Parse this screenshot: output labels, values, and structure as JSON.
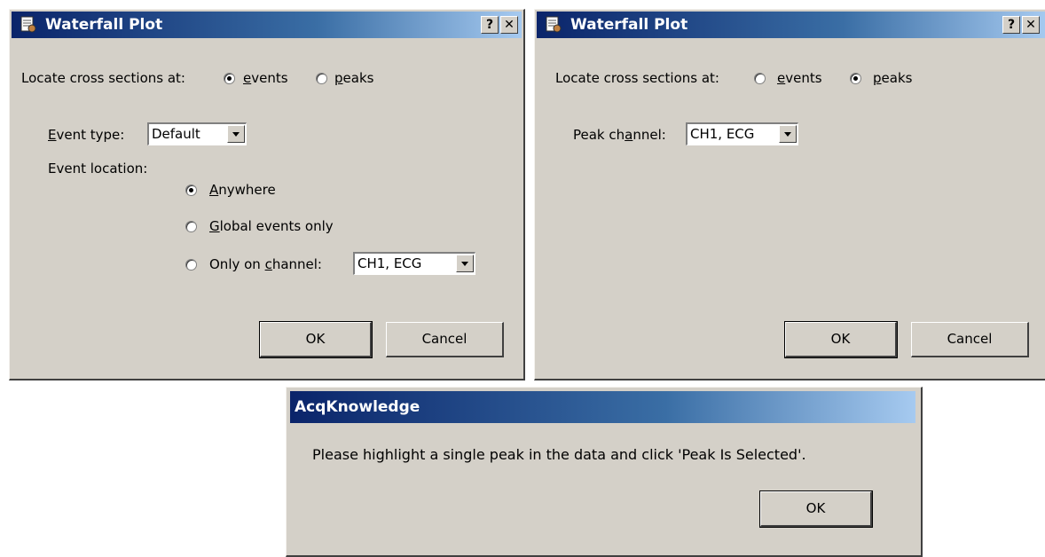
{
  "dialog_events": {
    "title": "Waterfall Plot",
    "help_glyph": "?",
    "close_glyph": "✕",
    "locate_label": "Locate cross sections at:",
    "events_option": {
      "access": "e",
      "rest": "vents",
      "selected": true
    },
    "peaks_option": {
      "access": "p",
      "rest": "eaks",
      "selected": false
    },
    "event_type_label": {
      "access": "E",
      "rest": "vent type:"
    },
    "event_type_value": "Default",
    "event_location_label": "Event location:",
    "anywhere_option": {
      "access": "A",
      "rest": "nywhere",
      "selected": true
    },
    "global_option": {
      "access": "G",
      "rest": "lobal events only",
      "selected": false
    },
    "channel_option": {
      "pre": "Only on ",
      "access": "c",
      "rest": "hannel:",
      "selected": false
    },
    "channel_value": "CH1, ECG",
    "ok_label": "OK",
    "cancel_label": "Cancel"
  },
  "dialog_peaks": {
    "title": "Waterfall Plot",
    "help_glyph": "?",
    "close_glyph": "✕",
    "locate_label": "Locate cross sections at:",
    "events_option": {
      "access": "e",
      "rest": "vents",
      "selected": false
    },
    "peaks_option": {
      "access": "p",
      "rest": "eaks",
      "selected": true
    },
    "peak_channel_label": {
      "pre": "Peak ch",
      "access": "a",
      "rest": "nnel:"
    },
    "peak_channel_value": "CH1, ECG",
    "ok_label": "OK",
    "cancel_label": "Cancel"
  },
  "dialog_message": {
    "title": "AcqKnowledge",
    "message": "Please highlight a single peak in the data and click 'Peak Is Selected'.",
    "ok_label": "OK"
  },
  "icons": [
    "app-icon",
    "help-icon",
    "close-icon",
    "dropdown-arrow-icon"
  ],
  "colors": {
    "face": "#d4d0c8",
    "title_start": "#0a246a",
    "title_end": "#a6caf0"
  }
}
